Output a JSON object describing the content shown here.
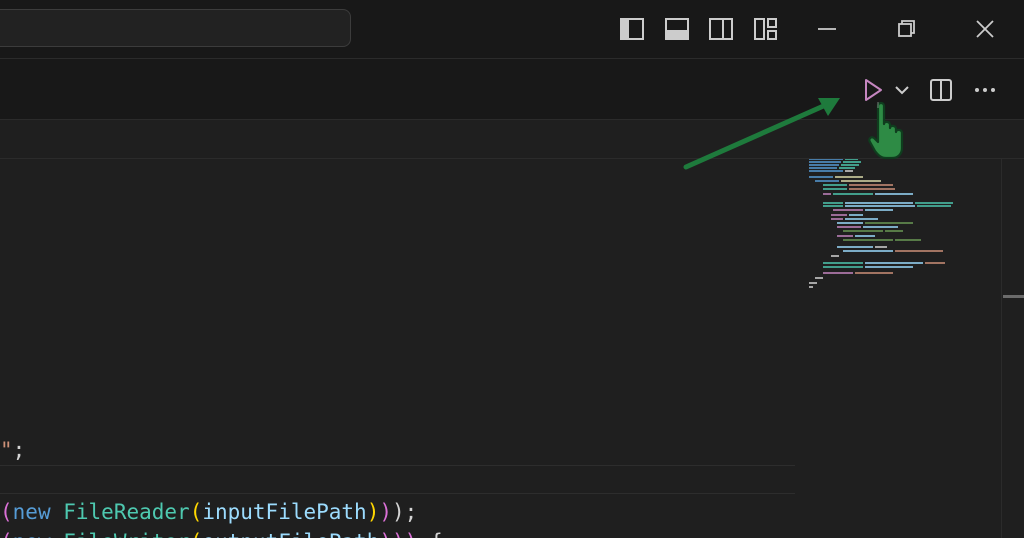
{
  "titlebar": {
    "icons": [
      "toggle-primary-sidebar-icon",
      "toggle-panel-icon",
      "toggle-secondary-sidebar-icon",
      "customize-layout-icon"
    ],
    "window_controls": [
      "minimize-icon",
      "restore-icon",
      "close-icon"
    ]
  },
  "editor_actions": {
    "icons": [
      "run-icon",
      "run-dropdown-chevron-icon",
      "split-editor-icon",
      "more-actions-icon"
    ]
  },
  "code": {
    "line1": {
      "str": "\"",
      "semi": ";"
    },
    "line2": {
      "open_paren": "(",
      "kw": "new",
      "type": "FileReader",
      "inner_open": "(",
      "var": "inputFilePath",
      "inner_close": ")",
      "close_paren": ")",
      "semi": ");"
    },
    "line3": {
      "open_paren": "(",
      "kw": "new",
      "type": "FileWriter",
      "inner_open": "(",
      "var": "outputFilePath",
      "close": ")))",
      "brace": " {"
    }
  },
  "colors": {
    "accent_arrow": "#1e7a3c",
    "cursor_hand": "#2e8b45",
    "run_icon": "#c586c0"
  }
}
